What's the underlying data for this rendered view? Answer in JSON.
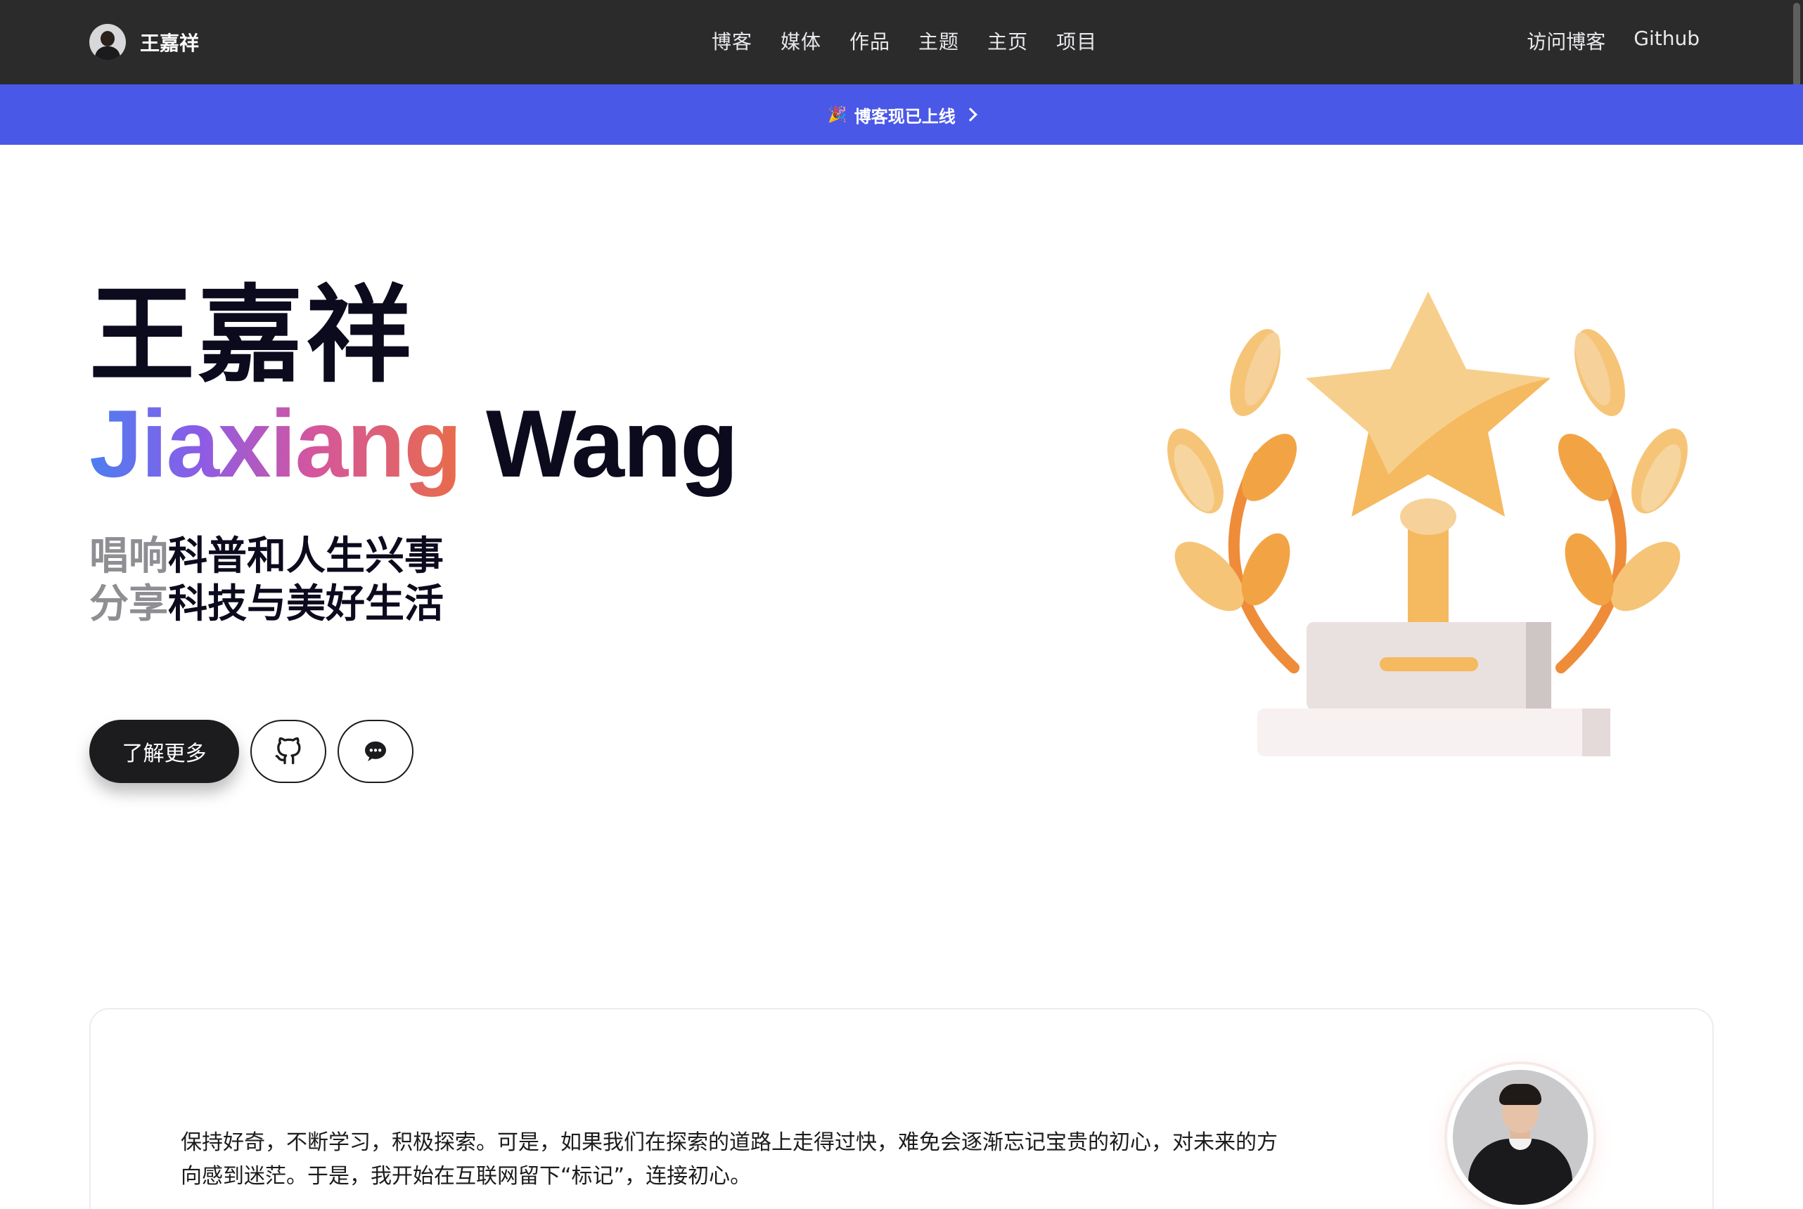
{
  "nav": {
    "brand_name": "王嘉祥",
    "links": [
      "博客",
      "媒体",
      "作品",
      "主题",
      "主页",
      "项目"
    ],
    "right_links": [
      "访问博客",
      "Github"
    ]
  },
  "banner": {
    "emoji": "🎉",
    "text": "博客现已上线"
  },
  "hero": {
    "name_cn": "王嘉祥",
    "name_en_first": "Jiaxiang",
    "name_en_last": "Wang",
    "tagline_1_muted": "唱响",
    "tagline_1_strong": "科普和人生兴事",
    "tagline_2_muted": "分享",
    "tagline_2_strong": "科技与美好生活",
    "primary_button": "了解更多"
  },
  "about": {
    "text": "保持好奇，不断学习，积极探索。可是，如果我们在探索的道路上走得过快，难免会逐渐忘记宝贵的初心，对未来的方向感到迷茫。于是，我开始在互联网留下“标记”，连接初心。"
  },
  "colors": {
    "nav_bg": "#2b2b2c",
    "banner_bg": "#4a58e8",
    "trophy_gold": "#f5b95f",
    "laurel_orange": "#ee8c3a"
  },
  "icons": [
    "github-icon",
    "wechat-icon",
    "chevron-right-icon",
    "trophy-illustration"
  ]
}
